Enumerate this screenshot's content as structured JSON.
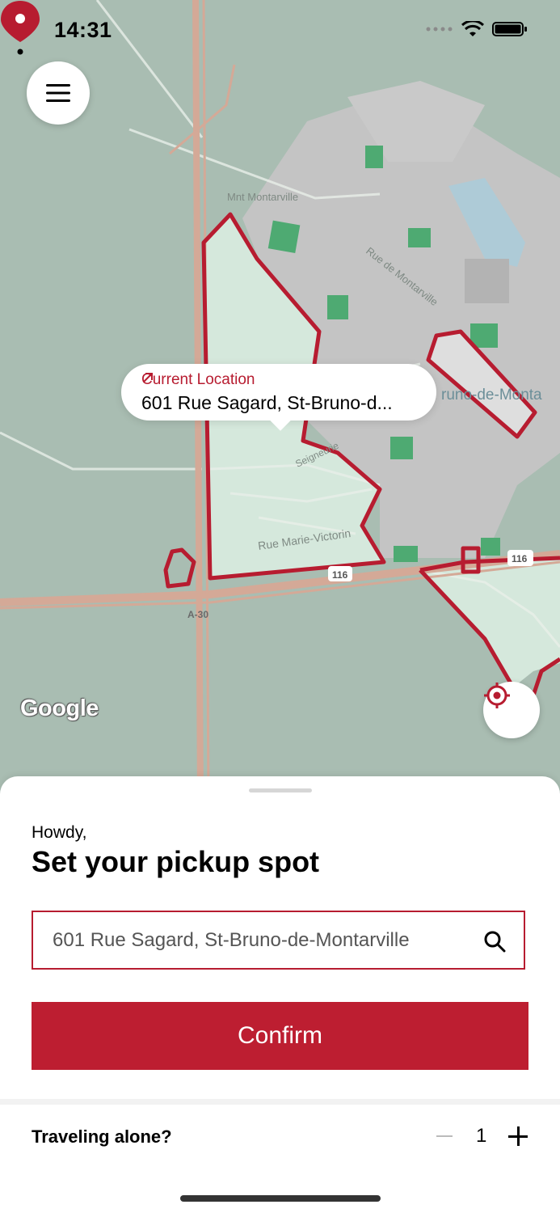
{
  "status_bar": {
    "time": "14:31"
  },
  "map": {
    "labels": {
      "street_1": "Mnt Montarville",
      "street_2": "Rue de Montarville",
      "street_3": "Rue Marie-Victorin",
      "street_4": "Seigneurie",
      "city": "runo-de-Monta",
      "route_116a": "116",
      "route_116b": "116",
      "highway": "A-30"
    },
    "bubble": {
      "label": "Current Location",
      "address": "601 Rue Sagard, St-Bruno-d..."
    },
    "attribution": "Google",
    "colors": {
      "accent": "#b71c30",
      "zone_fill": "#d5e8dc",
      "urban": "#c3c3c3",
      "base": "#a9bdb2"
    }
  },
  "sheet": {
    "greeting": "Howdy,",
    "title": "Set your pickup spot",
    "search": {
      "value": "601 Rue Sagard, St-Bruno-de-Montarville",
      "icon": "search-icon"
    },
    "confirm_label": "Confirm",
    "traveling": {
      "label": "Traveling alone?",
      "count": "1"
    }
  }
}
